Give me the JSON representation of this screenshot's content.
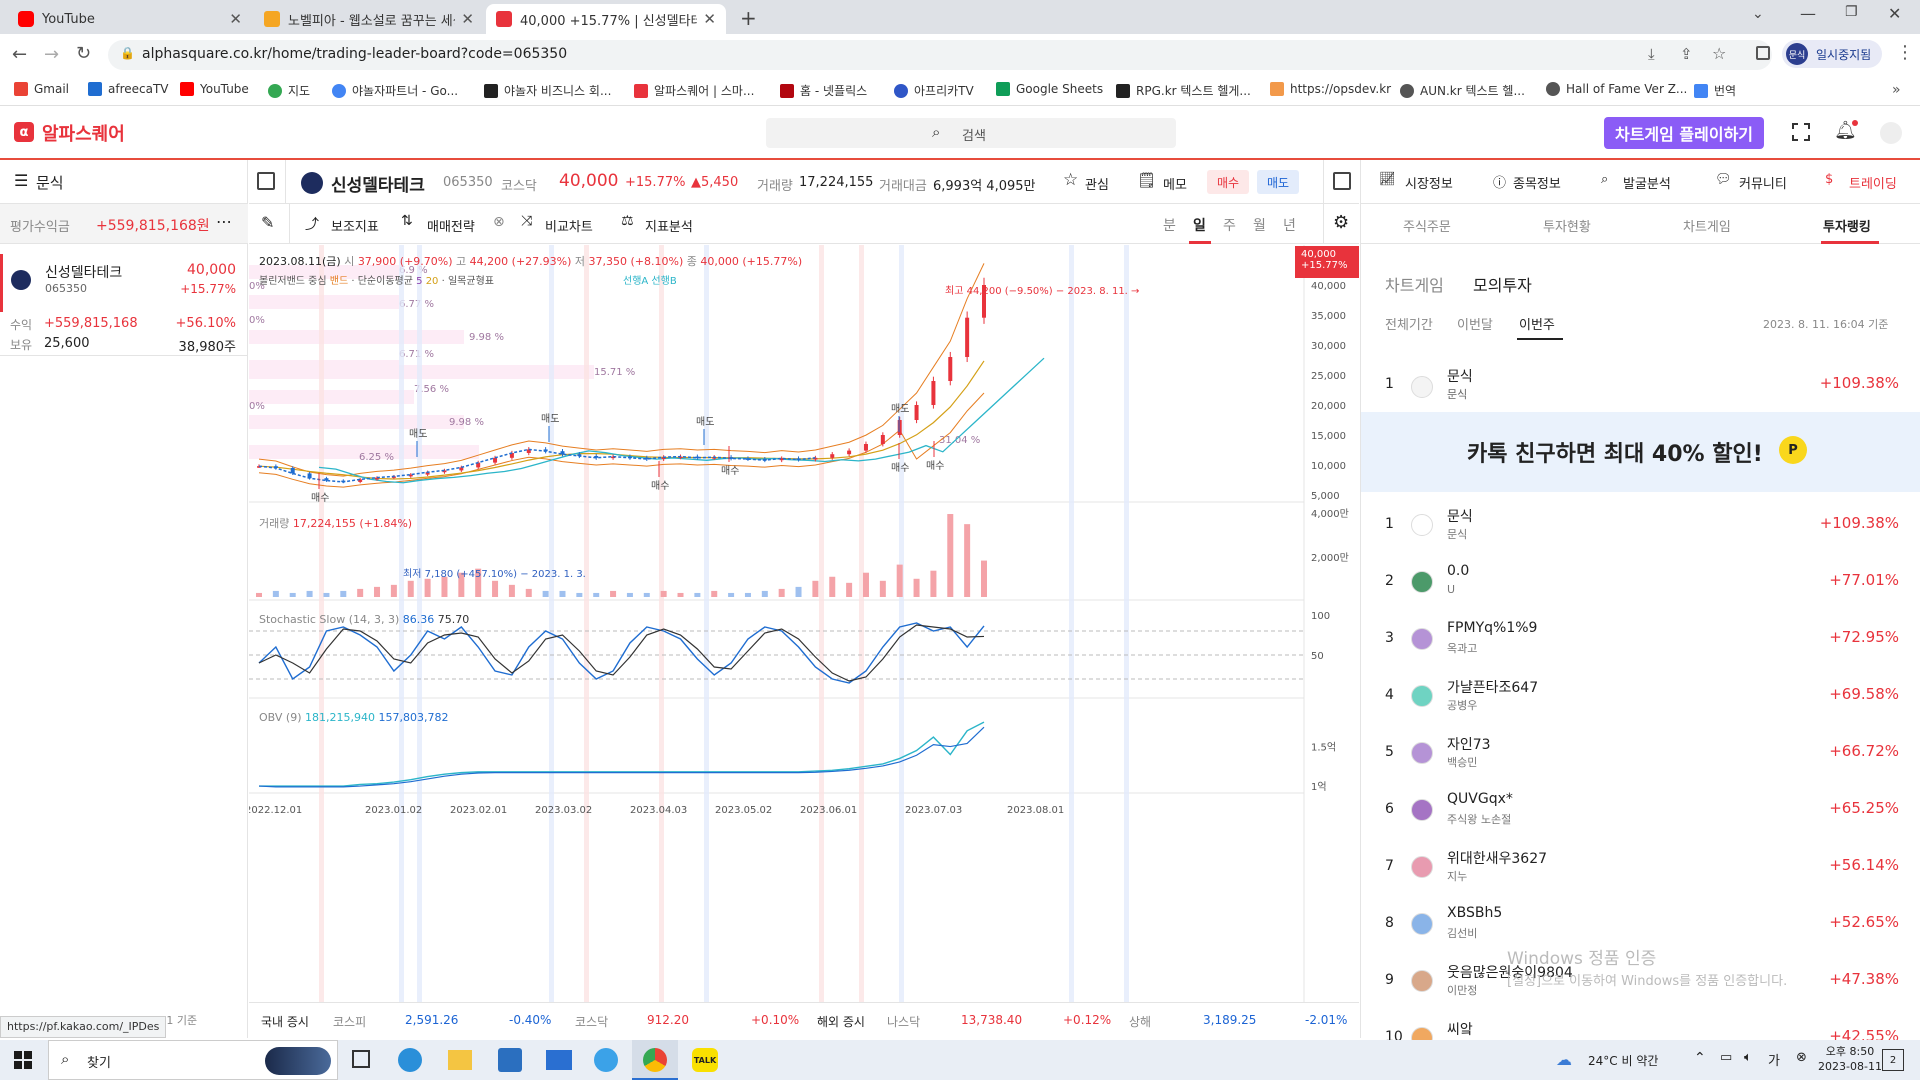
{
  "browser": {
    "tabs": [
      {
        "label": "YouTube",
        "color": "#ff0000"
      },
      {
        "label": "노벨피아 - 웹소설로 꿈꾸는 세상",
        "color": "#f5a623"
      },
      {
        "label": "40,000 +15.77% | 신성델타테크",
        "color": "#e8333c"
      }
    ],
    "url": "alphasquare.co.kr/home/trading-leader-board?code=065350",
    "profile_label": "일시중지됨",
    "profile_avatar": "문식",
    "bookmarks": [
      "Gmail",
      "afreecaTV",
      "YouTube",
      "지도",
      "야놀자파트너 - Go...",
      "야놀자 비즈니스 회...",
      "알파스퀘어 | 스마...",
      "홈 - 넷플릭스",
      "아프리카TV",
      "Google Sheets",
      "RPG.kr 텍스트 헬게...",
      "https://opsdev.kr",
      "AUN.kr 텍스트 헬...",
      "Hall of Fame Ver Z...",
      "번역"
    ]
  },
  "app": {
    "logo": "알파스퀘어",
    "search_placeholder": "검색",
    "game_banner": "차트게임 플레이하기"
  },
  "account": {
    "user": "문식",
    "eval_label": "평가수익금",
    "eval_value": "+559,815,168원"
  },
  "holding": {
    "name": "신성델타테크",
    "code": "065350",
    "price": "40,000",
    "change": "+15.77%",
    "profit_label": "수익",
    "profit_value": "+559,815,168",
    "profit_pct": "+56.10%",
    "hold_label": "보유",
    "hold_price": "25,600",
    "hold_qty": "38,980주",
    "footer_date": "2023. 8. 11. 17:00:01 기준"
  },
  "stock_header": {
    "name": "신성델타테크",
    "code": "065350",
    "market": "코스닥",
    "price": "40,000",
    "change_pct": "+15.77%",
    "change_abs": "▲5,450",
    "volume_label": "거래량",
    "volume": "17,224,155",
    "amount_label": "거래대금",
    "amount": "6,993억 4,095만",
    "fav_label": "관심",
    "memo_label": "메모",
    "buy_label": "매수",
    "sell_label": "매도"
  },
  "toolbar": {
    "indicator": "보조지표",
    "strategy": "매매전략",
    "compare": "비교차트",
    "analysis": "지표분석",
    "periods": [
      "분",
      "일",
      "주",
      "월",
      "년"
    ],
    "active_period": "일"
  },
  "chart_info": {
    "ohlc_line": "2023.08.11(금)",
    "open_label": "시",
    "open": "37,900 (+9.70%)",
    "high_label": "고",
    "high": "44,200 (+27.93%)",
    "low_label": "저",
    "low": "37,350 (+8.10%)",
    "close_label": "종",
    "close": "40,000 (+15.77%)",
    "legend_bb": "볼린저밴드 중심",
    "legend_band": "밴드",
    "legend_ma": "단순이동평균",
    "legend_ma5": "5",
    "legend_ma20": "20",
    "legend_ichimoku": "일목균형표",
    "legend_span": "선행A 선행B",
    "high_note": "최고 44,200 (−9.50%) − 2023. 8. 11. →",
    "low_note": "최저 7,180 (+457.10%) − 2023. 1. 3.",
    "price_tag": "40,000",
    "price_tag_pct": "+15.77%",
    "volume_label": "거래량",
    "volume_value": "17,224,155 (+1.84%)",
    "stoch_label": "Stochastic Slow",
    "stoch_params": "(14, 3, 3)",
    "stoch_k": "86.36",
    "stoch_d": "75.70",
    "obv_label": "OBV",
    "obv_params": "(9)",
    "obv_v1": "181,215,940",
    "obv_v2": "157,803,782",
    "buy_marker": "매수",
    "sell_marker": "매도",
    "vp_labels": [
      "6.9 %",
      "0%",
      "6.77 %",
      "0%",
      "9.98 %",
      "6.71 %",
      "15.71 %",
      "7.56 %",
      "0%",
      "9.98 %",
      "6.25 %",
      "31.04 %"
    ]
  },
  "chart_data": {
    "type": "line",
    "title": "",
    "x_ticks": [
      "2022.12.01",
      "2023.01.02",
      "2023.02.01",
      "2023.03.02",
      "2023.04.03",
      "2023.05.02",
      "2023.06.01",
      "2023.07.03",
      "2023.08.01"
    ],
    "price_axis": [
      "45,000",
      "40,000",
      "35,000",
      "30,000",
      "25,000",
      "20,000",
      "15,000",
      "10,000",
      "5,000"
    ],
    "volume_axis": [
      "4,000만",
      "2,000만"
    ],
    "stoch_axis": [
      "100",
      "50"
    ],
    "obv_axis": [
      "1.5억",
      "1억"
    ],
    "ylim": [
      5000,
      45000
    ],
    "close_series": [
      9800,
      9500,
      8600,
      7800,
      7400,
      7180,
      7600,
      7900,
      8100,
      8400,
      8800,
      9100,
      9600,
      10400,
      11200,
      12000,
      12600,
      12300,
      11800,
      11500,
      11200,
      11400,
      11200,
      11000,
      11300,
      11400,
      11200,
      11300,
      11100,
      11000,
      10800,
      11100,
      10900,
      11200,
      11800,
      12400,
      13500,
      15000,
      17500,
      20000,
      24000,
      28000,
      34550,
      40000
    ],
    "volume_series": [
      0.2,
      0.3,
      0.2,
      0.3,
      0.2,
      0.3,
      0.4,
      0.5,
      0.6,
      0.8,
      0.9,
      1.0,
      1.2,
      1.4,
      0.8,
      0.6,
      0.4,
      0.3,
      0.3,
      0.2,
      0.2,
      0.3,
      0.2,
      0.2,
      0.3,
      0.2,
      0.2,
      0.3,
      0.2,
      0.2,
      0.3,
      0.4,
      0.5,
      0.8,
      1.0,
      0.7,
      1.2,
      0.8,
      1.6,
      0.9,
      1.3,
      4.1,
      3.6,
      1.8
    ],
    "stoch_k": [
      40,
      60,
      20,
      35,
      80,
      85,
      75,
      60,
      30,
      50,
      80,
      70,
      85,
      60,
      30,
      25,
      60,
      80,
      70,
      40,
      20,
      30,
      65,
      85,
      80,
      70,
      45,
      25,
      40,
      70,
      85,
      80,
      60,
      35,
      20,
      15,
      30,
      60,
      85,
      90,
      80,
      85,
      60,
      86.36
    ],
    "obv_series": [
      1.0,
      1.0,
      1.0,
      1.0,
      1.0,
      1.0,
      1.02,
      1.03,
      1.05,
      1.08,
      1.12,
      1.15,
      1.17,
      1.18,
      1.18,
      1.18,
      1.18,
      1.18,
      1.18,
      1.18,
      1.18,
      1.18,
      1.18,
      1.18,
      1.18,
      1.18,
      1.18,
      1.18,
      1.18,
      1.18,
      1.18,
      1.18,
      1.18,
      1.19,
      1.2,
      1.22,
      1.25,
      1.28,
      1.35,
      1.45,
      1.62,
      1.4,
      1.7,
      1.81
    ]
  },
  "right_panel": {
    "top_tabs": [
      "시장정보",
      "종목정보",
      "발굴분석",
      "커뮤니티",
      "트레이딩"
    ],
    "active_top_tab": "트레이딩",
    "sub_tabs": [
      "주식주문",
      "투자현황",
      "차트게임",
      "투자랭킹"
    ],
    "active_sub_tab": "투자랭킹",
    "mode_tabs": [
      "차트게임",
      "모의투자"
    ],
    "active_mode_tab": "모의투자",
    "range_tabs": [
      "전체기간",
      "이번달",
      "이번주"
    ],
    "active_range_tab": "이번주",
    "date": "2023. 8. 11. 16:04 기준",
    "my_rank": {
      "rank": "1",
      "name": "문식",
      "sub": "문식",
      "return": "+109.38%"
    },
    "banner_text": "카톡 친구하면 최대 40% 할인!",
    "rankings": [
      {
        "rank": "1",
        "name": "문식",
        "sub": "문식",
        "return": "+109.38%",
        "color": "#ffffff"
      },
      {
        "rank": "2",
        "name": "0.0",
        "sub": "U",
        "return": "+77.01%",
        "color": "#4c9a6a"
      },
      {
        "rank": "3",
        "name": "FPMYq%1%9",
        "sub": "옥과고",
        "return": "+72.95%",
        "color": "#b593d6"
      },
      {
        "rank": "4",
        "name": "가냘픈타조647",
        "sub": "공병우",
        "return": "+69.58%",
        "color": "#6fd3c2"
      },
      {
        "rank": "5",
        "name": "자인73",
        "sub": "백승민",
        "return": "+66.72%",
        "color": "#b593d6"
      },
      {
        "rank": "6",
        "name": "QUVGqx*",
        "sub": "주식왕 노손절",
        "return": "+65.25%",
        "color": "#a574c4"
      },
      {
        "rank": "7",
        "name": "위대한새우3627",
        "sub": "지누",
        "return": "+56.14%",
        "color": "#e89bb0"
      },
      {
        "rank": "8",
        "name": "XBSBh5",
        "sub": "김선비",
        "return": "+52.65%",
        "color": "#8ab4e8"
      },
      {
        "rank": "9",
        "name": "웃음많은원숭이9804",
        "sub": "이만정",
        "return": "+47.38%",
        "color": "#d8a88a"
      },
      {
        "rank": "10",
        "name": "씨앜",
        "sub": "정보로",
        "return": "+42.55%",
        "color": "#f0a860"
      }
    ],
    "watermark_1": "Windows 정품 인증",
    "watermark_2": "[설정]으로 이동하여 Windows를 정품 인증합니다."
  },
  "market_bar": {
    "domestic_label": "국내 증시",
    "kospi_label": "코스피",
    "kospi": "2,591.26",
    "kospi_chg": "-0.40%",
    "kosdaq_label": "코스닥",
    "kosdaq": "912.20",
    "kosdaq_chg": "+0.10%",
    "foreign_label": "해외 증시",
    "nasdaq_label": "나스닥",
    "nasdaq": "13,738.40",
    "nasdaq_chg": "+0.12%",
    "sh_label": "상해",
    "sh": "3,189.25",
    "sh_chg": "-2.01%"
  },
  "status_url": "https://pf.kakao.com/_IPDes",
  "taskbar": {
    "search": "찾기",
    "weather": "24°C 비 약간",
    "time": "오후 8:50",
    "date": "2023-08-11",
    "notif": "2"
  }
}
